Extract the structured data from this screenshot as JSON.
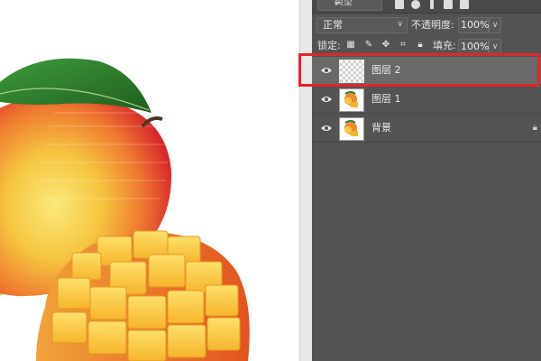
{
  "layers_panel": {
    "kind_filter": {
      "label": "类型"
    },
    "blend_mode": {
      "value": "正常"
    },
    "opacity": {
      "label": "不透明度:",
      "value": "100%"
    },
    "lock": {
      "label": "锁定:"
    },
    "fill": {
      "label": "填充:",
      "value": "100%"
    },
    "layers": [
      {
        "name": "图层 2",
        "selected": true,
        "thumbnail": "transparent-checkerboard",
        "visible": true
      },
      {
        "name": "图层 1",
        "selected": false,
        "thumbnail": "mango",
        "visible": true
      },
      {
        "name": "背景",
        "selected": false,
        "thumbnail": "mango",
        "visible": true,
        "locked": true
      }
    ]
  },
  "canvas": {
    "image": "mango-illustration"
  },
  "annotation": {
    "highlight_color": "#e0262b"
  },
  "colors": {
    "panel_bg": "#535353",
    "selected_row": "#696969"
  }
}
